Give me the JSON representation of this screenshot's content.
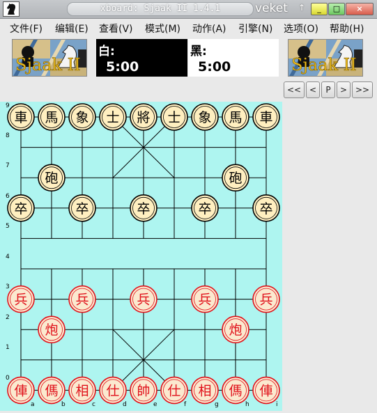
{
  "window": {
    "title": "xboard: Sjaak II 1.4.1",
    "user": "veket",
    "close_glyph": "×",
    "min_glyph": "_",
    "max_glyph": "□",
    "arrow_glyph": "↑"
  },
  "menu": [
    "文件(F)",
    "编辑(E)",
    "查看(V)",
    "模式(M)",
    "动作(A)",
    "引擎(N)",
    "选项(O)",
    "帮助(H)"
  ],
  "logos": {
    "left_text": "Sjaak II",
    "right_text": "Sjaak II"
  },
  "clocks": {
    "white_label": "白:",
    "white_time": "5:00",
    "black_label": "黑:",
    "black_time": "5:00"
  },
  "nav_buttons": [
    "<<",
    "<",
    "P",
    ">",
    ">>"
  ],
  "board": {
    "ranks": [
      "9",
      "8",
      "7",
      "6",
      "5",
      "4",
      "3",
      "2",
      "1",
      "0"
    ],
    "files": [
      "a",
      "b",
      "c",
      "d",
      "e",
      "f",
      "g",
      "h",
      "i"
    ],
    "colors": {
      "background": "#aef5f0",
      "line": "#000000",
      "black_piece_text": "#000000",
      "black_piece_fill": "#ffefc0",
      "red_piece_text": "#e0101a",
      "red_piece_fill": "#fbe9cf"
    },
    "pieces": [
      {
        "char": "車",
        "side": "black",
        "file": 0,
        "rank": 9
      },
      {
        "char": "馬",
        "side": "black",
        "file": 1,
        "rank": 9
      },
      {
        "char": "象",
        "side": "black",
        "file": 2,
        "rank": 9
      },
      {
        "char": "士",
        "side": "black",
        "file": 3,
        "rank": 9
      },
      {
        "char": "將",
        "side": "black",
        "file": 4,
        "rank": 9
      },
      {
        "char": "士",
        "side": "black",
        "file": 5,
        "rank": 9
      },
      {
        "char": "象",
        "side": "black",
        "file": 6,
        "rank": 9
      },
      {
        "char": "馬",
        "side": "black",
        "file": 7,
        "rank": 9
      },
      {
        "char": "車",
        "side": "black",
        "file": 8,
        "rank": 9
      },
      {
        "char": "砲",
        "side": "black",
        "file": 1,
        "rank": 7
      },
      {
        "char": "砲",
        "side": "black",
        "file": 7,
        "rank": 7
      },
      {
        "char": "卒",
        "side": "black",
        "file": 0,
        "rank": 6
      },
      {
        "char": "卒",
        "side": "black",
        "file": 2,
        "rank": 6
      },
      {
        "char": "卒",
        "side": "black",
        "file": 4,
        "rank": 6
      },
      {
        "char": "卒",
        "side": "black",
        "file": 6,
        "rank": 6
      },
      {
        "char": "卒",
        "side": "black",
        "file": 8,
        "rank": 6
      },
      {
        "char": "兵",
        "side": "red",
        "file": 0,
        "rank": 3
      },
      {
        "char": "兵",
        "side": "red",
        "file": 2,
        "rank": 3
      },
      {
        "char": "兵",
        "side": "red",
        "file": 4,
        "rank": 3
      },
      {
        "char": "兵",
        "side": "red",
        "file": 6,
        "rank": 3
      },
      {
        "char": "兵",
        "side": "red",
        "file": 8,
        "rank": 3
      },
      {
        "char": "炮",
        "side": "red",
        "file": 1,
        "rank": 2
      },
      {
        "char": "炮",
        "side": "red",
        "file": 7,
        "rank": 2
      },
      {
        "char": "俥",
        "side": "red",
        "file": 0,
        "rank": 0
      },
      {
        "char": "傌",
        "side": "red",
        "file": 1,
        "rank": 0
      },
      {
        "char": "相",
        "side": "red",
        "file": 2,
        "rank": 0
      },
      {
        "char": "仕",
        "side": "red",
        "file": 3,
        "rank": 0
      },
      {
        "char": "帥",
        "side": "red",
        "file": 4,
        "rank": 0
      },
      {
        "char": "仕",
        "side": "red",
        "file": 5,
        "rank": 0
      },
      {
        "char": "相",
        "side": "red",
        "file": 6,
        "rank": 0
      },
      {
        "char": "傌",
        "side": "red",
        "file": 7,
        "rank": 0
      },
      {
        "char": "俥",
        "side": "red",
        "file": 8,
        "rank": 0
      }
    ]
  }
}
